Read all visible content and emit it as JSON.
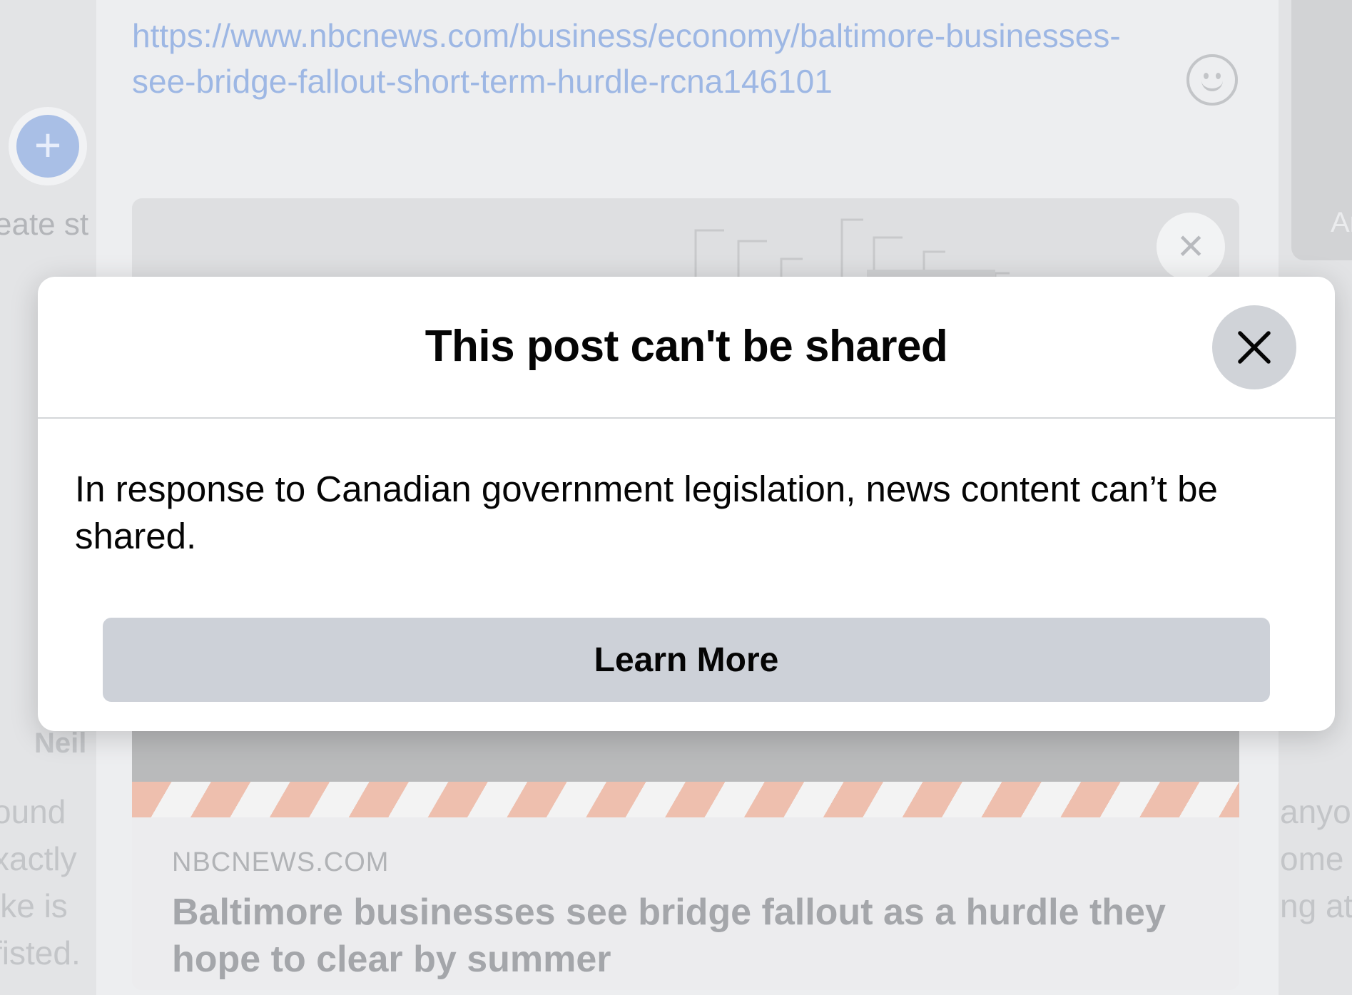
{
  "background": {
    "left_column": {
      "create_story_label": "eate st",
      "name_fragment": "Neil",
      "text_lines": [
        "ound",
        "xactly",
        "ike is",
        "fisted."
      ]
    },
    "right_column": {
      "card_label": "An",
      "text_lines": [
        "anyo",
        "ome v",
        "ng at"
      ]
    },
    "post": {
      "link_text": "https://www.nbcnews.com/business/economy/baltimore-businesses-see-bridge-fallout-short-term-hurdle-rcna146101",
      "preview": {
        "domain": "NBCNEWS.COM",
        "headline": "Baltimore businesses see bridge fallout as a hurdle they hope to clear by summer"
      }
    }
  },
  "modal": {
    "title": "This post can't be shared",
    "message": "In response to Canadian government legislation, news content can’t be shared.",
    "learn_more_label": "Learn More"
  },
  "icons": {
    "close": "close-icon",
    "emoji": "smiley-icon",
    "add": "plus-icon"
  },
  "colors": {
    "modal_button_bg": "#cdd1d8",
    "close_button_bg": "#d0d3d8",
    "link_color": "#9db7e4"
  }
}
